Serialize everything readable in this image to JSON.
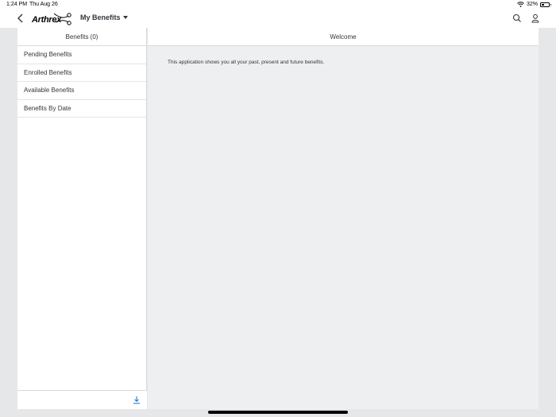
{
  "status_bar": {
    "time": "1:24 PM",
    "date": "Thu Aug 26",
    "battery_percent": "32%",
    "battery_level": 0.32,
    "icons": [
      "wifi-icon",
      "battery-icon"
    ]
  },
  "header": {
    "logo_text": "Arthrex",
    "app_title": "My Benefits",
    "icons": [
      "back-icon",
      "search-icon",
      "user-icon",
      "caret-down-icon"
    ]
  },
  "master": {
    "title": "Benefits (0)",
    "items": [
      {
        "label": "Pending Benefits"
      },
      {
        "label": "Enrolled Benefits"
      },
      {
        "label": "Available Benefits"
      },
      {
        "label": "Benefits By Date"
      }
    ],
    "footer_icon": "download-icon"
  },
  "detail": {
    "title": "Welcome",
    "message": "This application shows you all your past, present and future benefits."
  },
  "colors": {
    "background": "#e6e7e9",
    "panel": "#ffffff",
    "detail_background": "#edeff0",
    "text": "#32363a",
    "accent": "#0a6ed1"
  }
}
